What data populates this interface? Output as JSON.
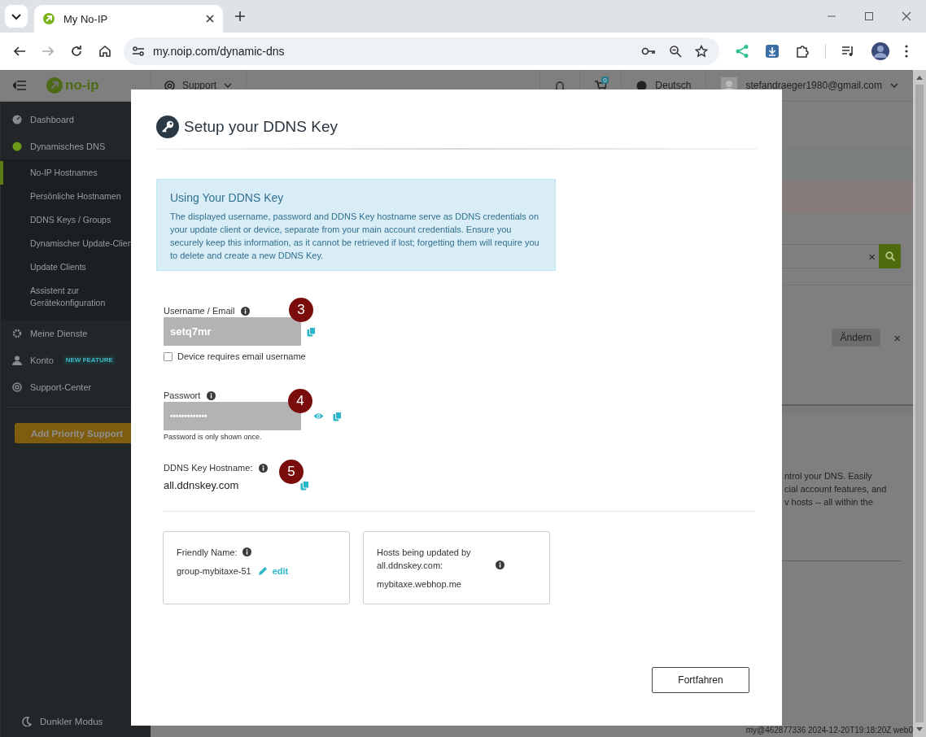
{
  "browser": {
    "tab_title": "My No-IP",
    "url": "my.noip.com/dynamic-dns"
  },
  "topbar": {
    "logo": "no-ip",
    "support": "Support",
    "cart_count": "0",
    "language": "Deutsch",
    "account": "stefandraeger1980@gmail.com"
  },
  "sidebar": {
    "items": [
      {
        "label": "Dashboard",
        "selected": false
      },
      {
        "label": "Dynamisches DNS",
        "selected": true,
        "children": [
          {
            "label": "No-IP Hostnames",
            "selected": true
          },
          {
            "label": "Persönliche Hostnamen",
            "selected": false
          },
          {
            "label": "DDNS Keys / Groups",
            "selected": false
          },
          {
            "label": "Dynamischer Update-Clien",
            "selected": false
          },
          {
            "label": "Update Clients",
            "selected": false
          },
          {
            "label": "Assistent zur Gerätekonfiguration",
            "selected": false
          }
        ]
      },
      {
        "label": "Meine Dienste",
        "selected": false
      },
      {
        "label": "Konto",
        "selected": false,
        "badge": "NEW FEATURE"
      },
      {
        "label": "Support-Center",
        "selected": false
      }
    ],
    "button": "Add Priority Support",
    "dark_mode": "Dunkler Modus"
  },
  "background": {
    "search_clear": "×",
    "change_button": "Ändern",
    "dismiss": "×",
    "text_lines": [
      "ntrol your DNS. Easily",
      "cial account features, and",
      "v hosts -- all within the"
    ],
    "footer": "my@462877336 2024-12-20T19:18:20Z web0"
  },
  "modal": {
    "title": "Setup your DDNS Key",
    "info": {
      "title": "Using Your DDNS Key",
      "text": "The displayed username, password and DDNS Key hostname serve as DDNS credentials on your update client or device, separate from your main account credentials. Ensure you securely keep this information, as it cannot be retrieved if lost; forgetting them will require you to delete and create a new DDNS Key."
    },
    "fields": [
      {
        "kind": "input",
        "label": "Username / Email",
        "value": "setq7mr",
        "marker": "3",
        "checkbox": {
          "label": "Device requires email username",
          "checked": false
        }
      },
      {
        "kind": "password",
        "label": "Passwort",
        "value": "•••••••••••••",
        "marker": "4",
        "hint": "Password is only shown once."
      },
      {
        "kind": "text",
        "label": "DDNS Key Hostname:",
        "value": "all.ddnskey.com",
        "marker": "5"
      }
    ],
    "cards": [
      {
        "label": "Friendly Name:",
        "value": "group-mybitaxe-51",
        "link": "edit"
      },
      {
        "label": "Hosts being updated by all.ddnskey.com:",
        "value": "mybitaxe.webhop.me"
      }
    ],
    "button": "Fortfahren"
  }
}
